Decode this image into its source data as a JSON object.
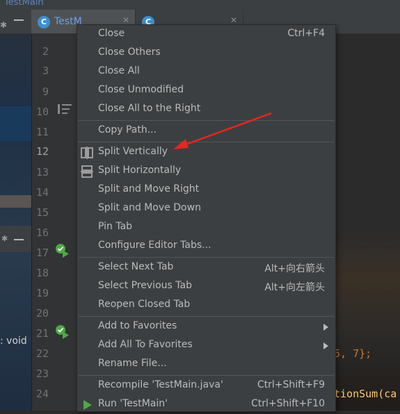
{
  "window": {
    "title": "TestMain"
  },
  "tabs": [
    {
      "label": "TestMain.java",
      "visible_text": "TestM",
      "active": true
    },
    {
      "label": "",
      "visible_text": "",
      "active": false
    }
  ],
  "gutter": {
    "line_numbers": [
      "2",
      "3",
      "9",
      "10",
      "11",
      "12",
      "13",
      "14",
      "15",
      "16",
      "17",
      "18",
      "19",
      "20",
      "21",
      "22",
      "23",
      "24"
    ],
    "current_line": "12"
  },
  "code": {
    "fragment_1": "5, 7};",
    "fragment_2": "tionSum(ca"
  },
  "left_panel": {
    "fragment": ": void"
  },
  "context_menu": {
    "items": [
      {
        "label": "Close",
        "shortcut": "Ctrl+F4"
      },
      {
        "label": "Close Others",
        "shortcut": ""
      },
      {
        "label": "Close All",
        "shortcut": ""
      },
      {
        "label": "Close Unmodified",
        "shortcut": ""
      },
      {
        "label": "Close All to the Right",
        "shortcut": ""
      },
      {
        "label": "Copy Path...",
        "shortcut": ""
      },
      {
        "label": "Split Vertically",
        "shortcut": "",
        "icon": "split-vertical-icon"
      },
      {
        "label": "Split Horizontally",
        "shortcut": "",
        "icon": "split-horizontal-icon"
      },
      {
        "label": "Split and Move Right",
        "shortcut": ""
      },
      {
        "label": "Split and Move Down",
        "shortcut": ""
      },
      {
        "label": "Pin Tab",
        "shortcut": ""
      },
      {
        "label": "Configure Editor Tabs...",
        "shortcut": ""
      },
      {
        "label": "Select Next Tab",
        "shortcut": "Alt+向右箭头"
      },
      {
        "label": "Select Previous Tab",
        "shortcut": "Alt+向左箭头"
      },
      {
        "label": "Reopen Closed Tab",
        "shortcut": ""
      },
      {
        "label": "Add to Favorites",
        "shortcut": "",
        "submenu": true
      },
      {
        "label": "Add All To Favorites",
        "shortcut": "",
        "submenu": true
      },
      {
        "label": "Rename File...",
        "shortcut": ""
      },
      {
        "label": "Recompile 'TestMain.java'",
        "shortcut": "Ctrl+Shift+F9"
      },
      {
        "label": "Run 'TestMain'",
        "shortcut": "Ctrl+Shift+F10",
        "icon": "run-icon"
      }
    ]
  },
  "colors": {
    "menu_background": "#3c3f41",
    "menu_text": "#bbbbbb",
    "current_line": "#52503a",
    "annotation_arrow": "#e8261f",
    "run_icon": "#4fa846"
  }
}
